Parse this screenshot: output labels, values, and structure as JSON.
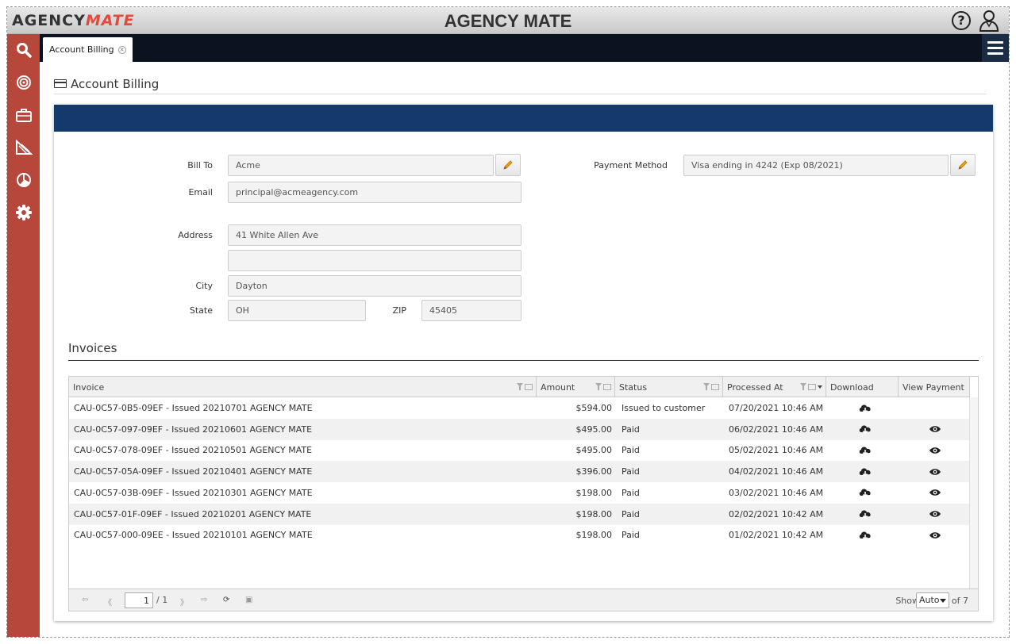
{
  "header": {
    "logo_agency": "AGENCY",
    "logo_mate": "MATE",
    "app_title": "AGENCY MATE",
    "help_label": "?"
  },
  "sidebar": {
    "items": [
      {
        "icon": "search-icon"
      },
      {
        "icon": "target-icon"
      },
      {
        "icon": "briefcase-icon"
      },
      {
        "icon": "reports-icon"
      },
      {
        "icon": "pie-chart-icon"
      },
      {
        "icon": "gear-icon"
      }
    ]
  },
  "tabs": [
    {
      "label": "Account Billing"
    }
  ],
  "page": {
    "title": "Account Billing"
  },
  "billing": {
    "bill_to_label": "Bill To",
    "bill_to_value": "Acme",
    "email_label": "Email",
    "email_value": "principal@acmeagency.com",
    "address_label": "Address",
    "address1_value": "41 White Allen Ave",
    "address2_value": "",
    "city_label": "City",
    "city_value": "Dayton",
    "state_label": "State",
    "state_value": "OH",
    "zip_label": "ZIP",
    "zip_value": "45405",
    "payment_method_label": "Payment Method",
    "payment_method_value": "Visa ending in 4242 (Exp 08/2021)"
  },
  "invoices": {
    "title": "Invoices",
    "columns": [
      "Invoice",
      "Amount",
      "Status",
      "Processed At",
      "Download",
      "View Payment"
    ],
    "rows": [
      {
        "invoice": "CAU-0C57-0B5-09EF - Issued 20210701 AGENCY MATE",
        "amount": "$594.00",
        "status": "Issued to customer",
        "processed_at": "07/20/2021 10:46 AM",
        "has_payment": false
      },
      {
        "invoice": "CAU-0C57-097-09EF - Issued 20210601 AGENCY MATE",
        "amount": "$495.00",
        "status": "Paid",
        "processed_at": "06/02/2021 10:46 AM",
        "has_payment": true
      },
      {
        "invoice": "CAU-0C57-078-09EF - Issued 20210501 AGENCY MATE",
        "amount": "$495.00",
        "status": "Paid",
        "processed_at": "05/02/2021 10:46 AM",
        "has_payment": true
      },
      {
        "invoice": "CAU-0C57-05A-09EF - Issued 20210401 AGENCY MATE",
        "amount": "$396.00",
        "status": "Paid",
        "processed_at": "04/02/2021 10:46 AM",
        "has_payment": true
      },
      {
        "invoice": "CAU-0C57-03B-09EF - Issued 20210301 AGENCY MATE",
        "amount": "$198.00",
        "status": "Paid",
        "processed_at": "03/02/2021 10:46 AM",
        "has_payment": true
      },
      {
        "invoice": "CAU-0C57-01F-09EF - Issued 20210201 AGENCY MATE",
        "amount": "$198.00",
        "status": "Paid",
        "processed_at": "02/02/2021 10:42 AM",
        "has_payment": true
      },
      {
        "invoice": "CAU-0C57-000-09EE - Issued 20210101 AGENCY MATE",
        "amount": "$198.00",
        "status": "Paid",
        "processed_at": "01/02/2021 10:42 AM",
        "has_payment": true
      }
    ],
    "pager": {
      "page": "1",
      "total_pages": "/ 1",
      "show_label": "Show",
      "show_value": "Auto",
      "of_label": "of 7"
    }
  },
  "colors": {
    "sidebar": "#b8473b",
    "panel_header": "#14396b",
    "tabstrip": "#0b1320",
    "logo_accent": "#e24b3c",
    "edit_pencil": "#f0a30a"
  }
}
